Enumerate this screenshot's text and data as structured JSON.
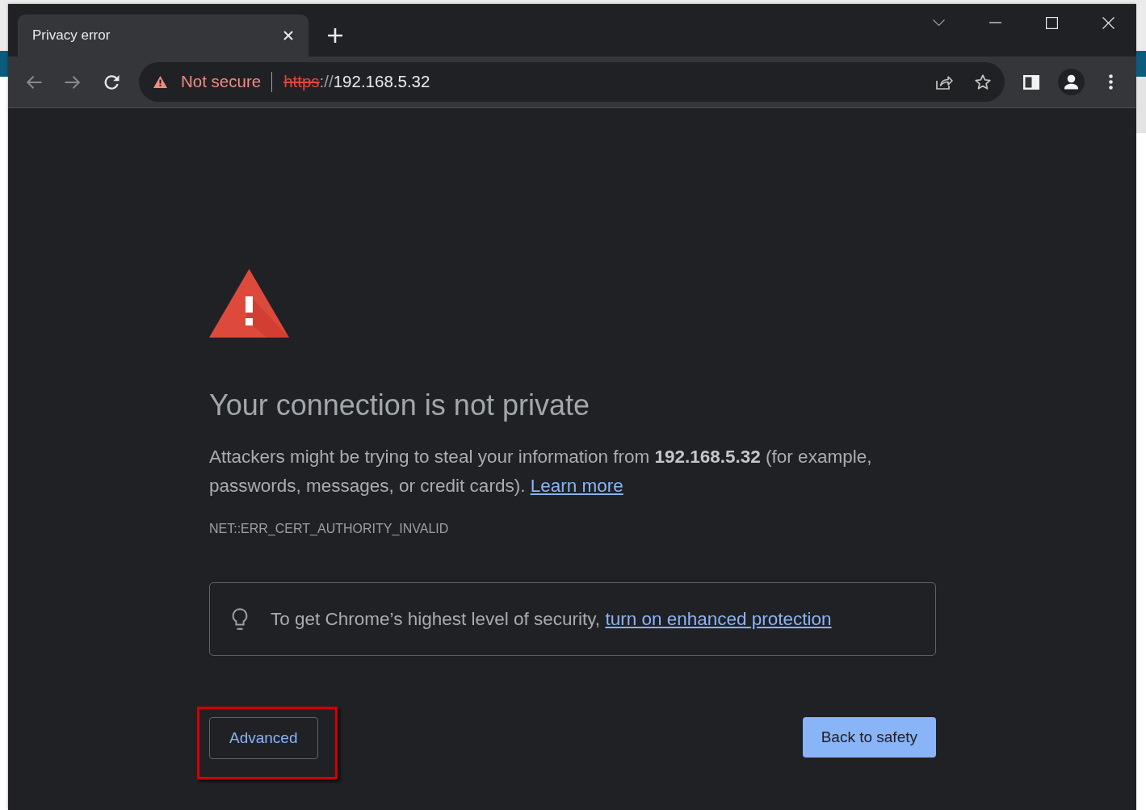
{
  "tabs": [
    {
      "title": "Privacy error",
      "selected": true
    }
  ],
  "nav_buttons": [
    {
      "kind": "back",
      "disabled": true
    },
    {
      "kind": "forward",
      "disabled": true
    },
    {
      "kind": "reload",
      "disabled": false
    }
  ],
  "address_bar": {
    "security_label": "Not secure",
    "scheme": "https",
    "separator": "://",
    "host": "192.168.5.32"
  },
  "page": {
    "heading": "Your connection is not private",
    "description": "Attackers might be trying to steal your information from **192.168.5.32** (for example, passwords, messages, or credit cards).",
    "learn_more": "Learn more",
    "error_code": "NET::ERR_CERT_AUTHORITY_INVALID",
    "enhanced_protection": {
      "text": "To get Chrome’s highest level of security,",
      "link": "turn on enhanced protection"
    },
    "buttons": [
      {
        "kind": "secondary",
        "label": "Advanced",
        "highlighted": true
      },
      {
        "kind": "primary",
        "label": "Back to safety",
        "highlighted": false
      }
    ]
  }
}
